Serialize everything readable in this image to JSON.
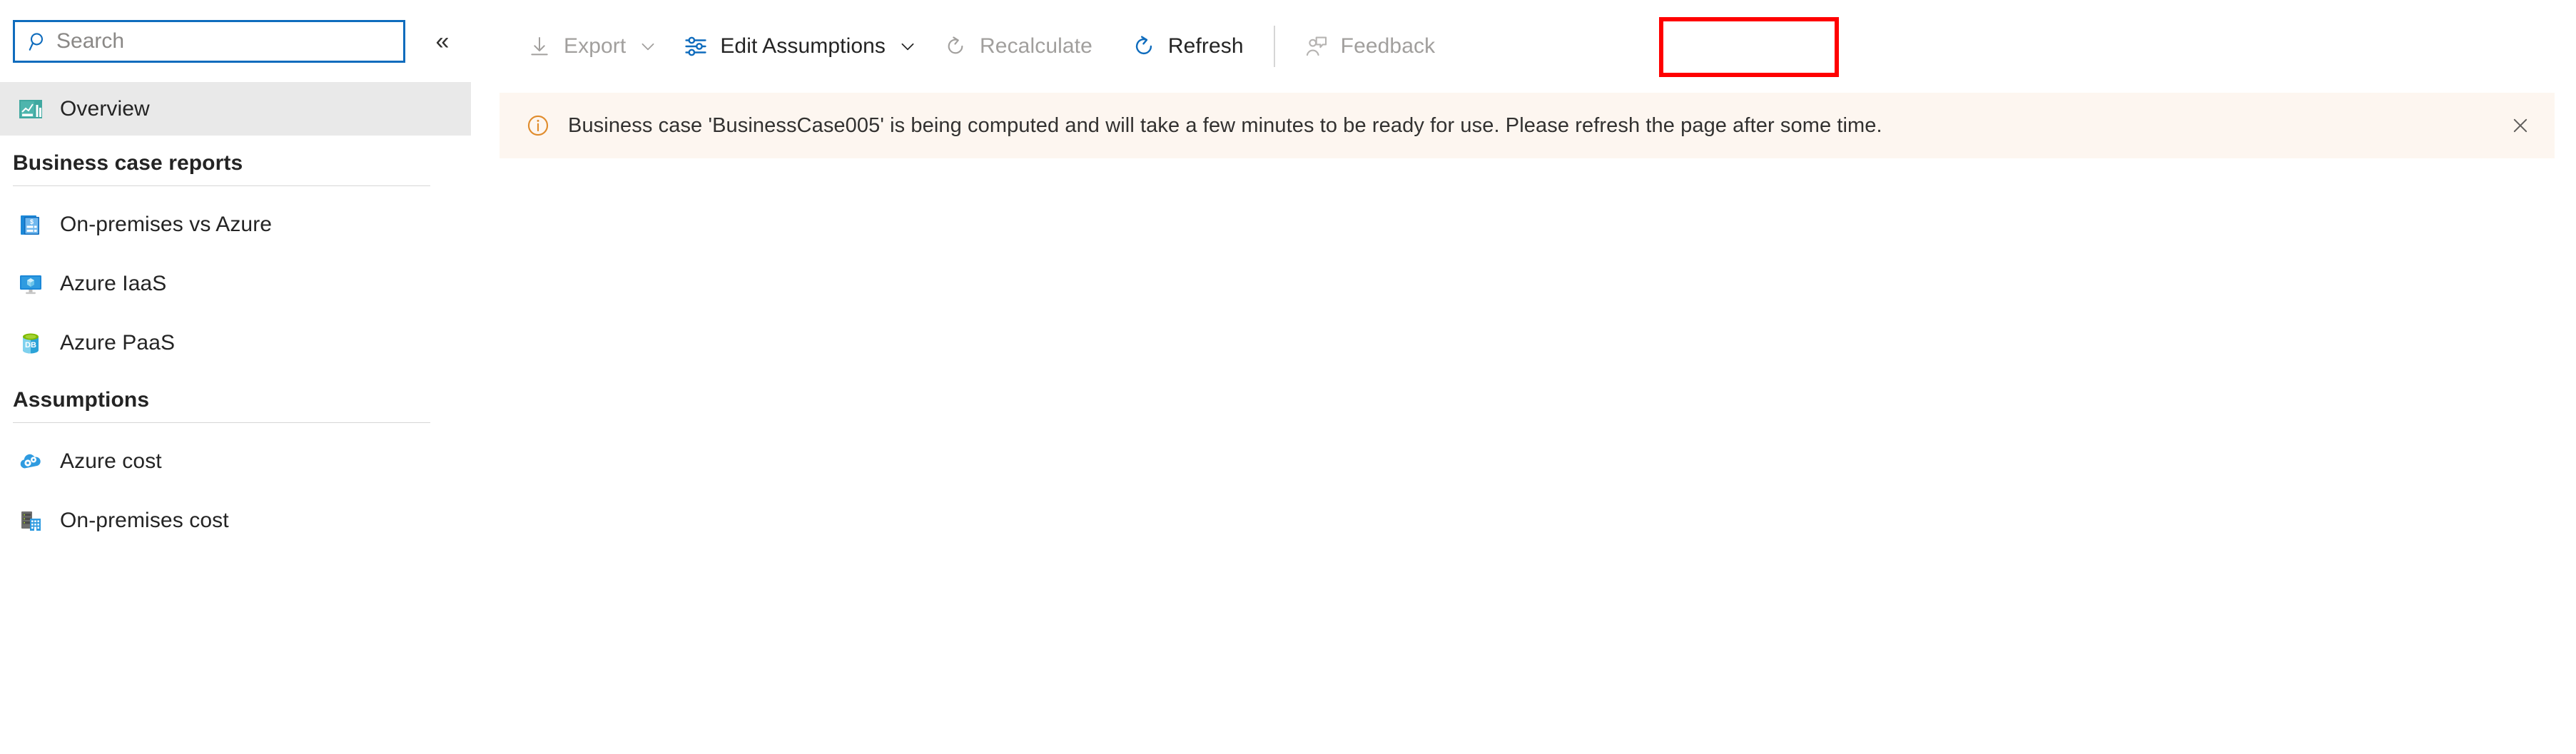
{
  "colors": {
    "accent": "#0f6cbd",
    "banner_bg": "#fdf6f0",
    "banner_icon": "#e08c2c",
    "selected_bg": "#e9e9e9",
    "disabled_text": "#a19f9d",
    "text": "#242424",
    "highlight": "#ff0000",
    "teal": "#3fa8a0",
    "db_green": "#7fba00",
    "server_grey": "#6d6d6d"
  },
  "sidebar": {
    "search": {
      "placeholder": "Search",
      "value": "",
      "icon": "search-icon"
    },
    "collapse": {
      "icon": "chevron-double-left-icon",
      "glyph": "«",
      "tooltip": "Collapse"
    },
    "overview": {
      "label": "Overview",
      "icon": "overview-chart-icon",
      "selected": true
    },
    "groups": [
      {
        "header": "Business case reports",
        "items": [
          {
            "label": "On-premises vs Azure",
            "icon": "invoice-dollar-icon"
          },
          {
            "label": "Azure IaaS",
            "icon": "virtual-machine-icon"
          },
          {
            "label": "Azure PaaS",
            "icon": "database-icon"
          }
        ]
      },
      {
        "header": "Assumptions",
        "items": [
          {
            "label": "Azure cost",
            "icon": "cloud-gears-icon"
          },
          {
            "label": "On-premises cost",
            "icon": "server-building-icon"
          }
        ]
      }
    ]
  },
  "toolbar": {
    "items": [
      {
        "label": "Export",
        "icon": "download-arrow-icon",
        "caret": true,
        "disabled": true,
        "name": "export-button"
      },
      {
        "label": "Edit Assumptions",
        "icon": "sliders-icon",
        "caret": true,
        "disabled": false,
        "name": "edit-assumptions-button"
      },
      {
        "label": "Recalculate",
        "icon": "recalculate-circle-arrow-icon",
        "caret": false,
        "disabled": true,
        "name": "recalculate-button"
      },
      {
        "label": "Refresh",
        "icon": "refresh-circle-arrow-icon",
        "caret": false,
        "disabled": false,
        "name": "refresh-button",
        "highlighted": true
      },
      {
        "label": "Feedback",
        "icon": "person-feedback-icon",
        "caret": false,
        "disabled": true,
        "name": "feedback-button"
      }
    ]
  },
  "banner": {
    "icon": "info-circle-icon",
    "message": "Business case 'BusinessCase005' is being computed and will take a few minutes to be ready for use. Please refresh the page after some time.",
    "business_case_name": "BusinessCase005",
    "close": {
      "icon": "close-icon",
      "glyph": "✕"
    }
  }
}
